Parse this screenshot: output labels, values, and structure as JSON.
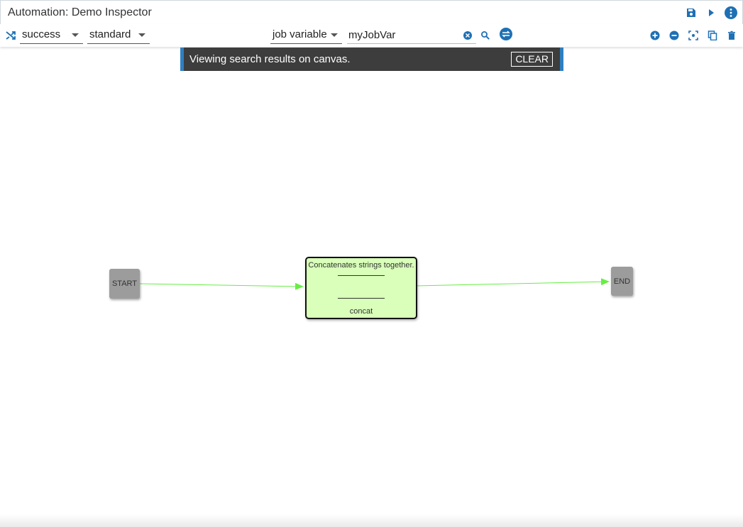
{
  "window": {
    "title": "Automation: Demo Inspector"
  },
  "toolbar": {
    "status_select": "success",
    "type_select": "standard",
    "search_scope": "job variable",
    "search_value": "myJobVar"
  },
  "snackbar": {
    "message": "Viewing search results on canvas.",
    "action": "CLEAR"
  },
  "canvas": {
    "start_label": "START",
    "end_label": "END",
    "task": {
      "description": "Concatenates strings together.",
      "name": "concat"
    }
  },
  "colors": {
    "accent": "#1e70b5",
    "edge": "#66ee44",
    "task_fill": "#d9ffba",
    "terminal_fill": "#9c9c9c"
  }
}
